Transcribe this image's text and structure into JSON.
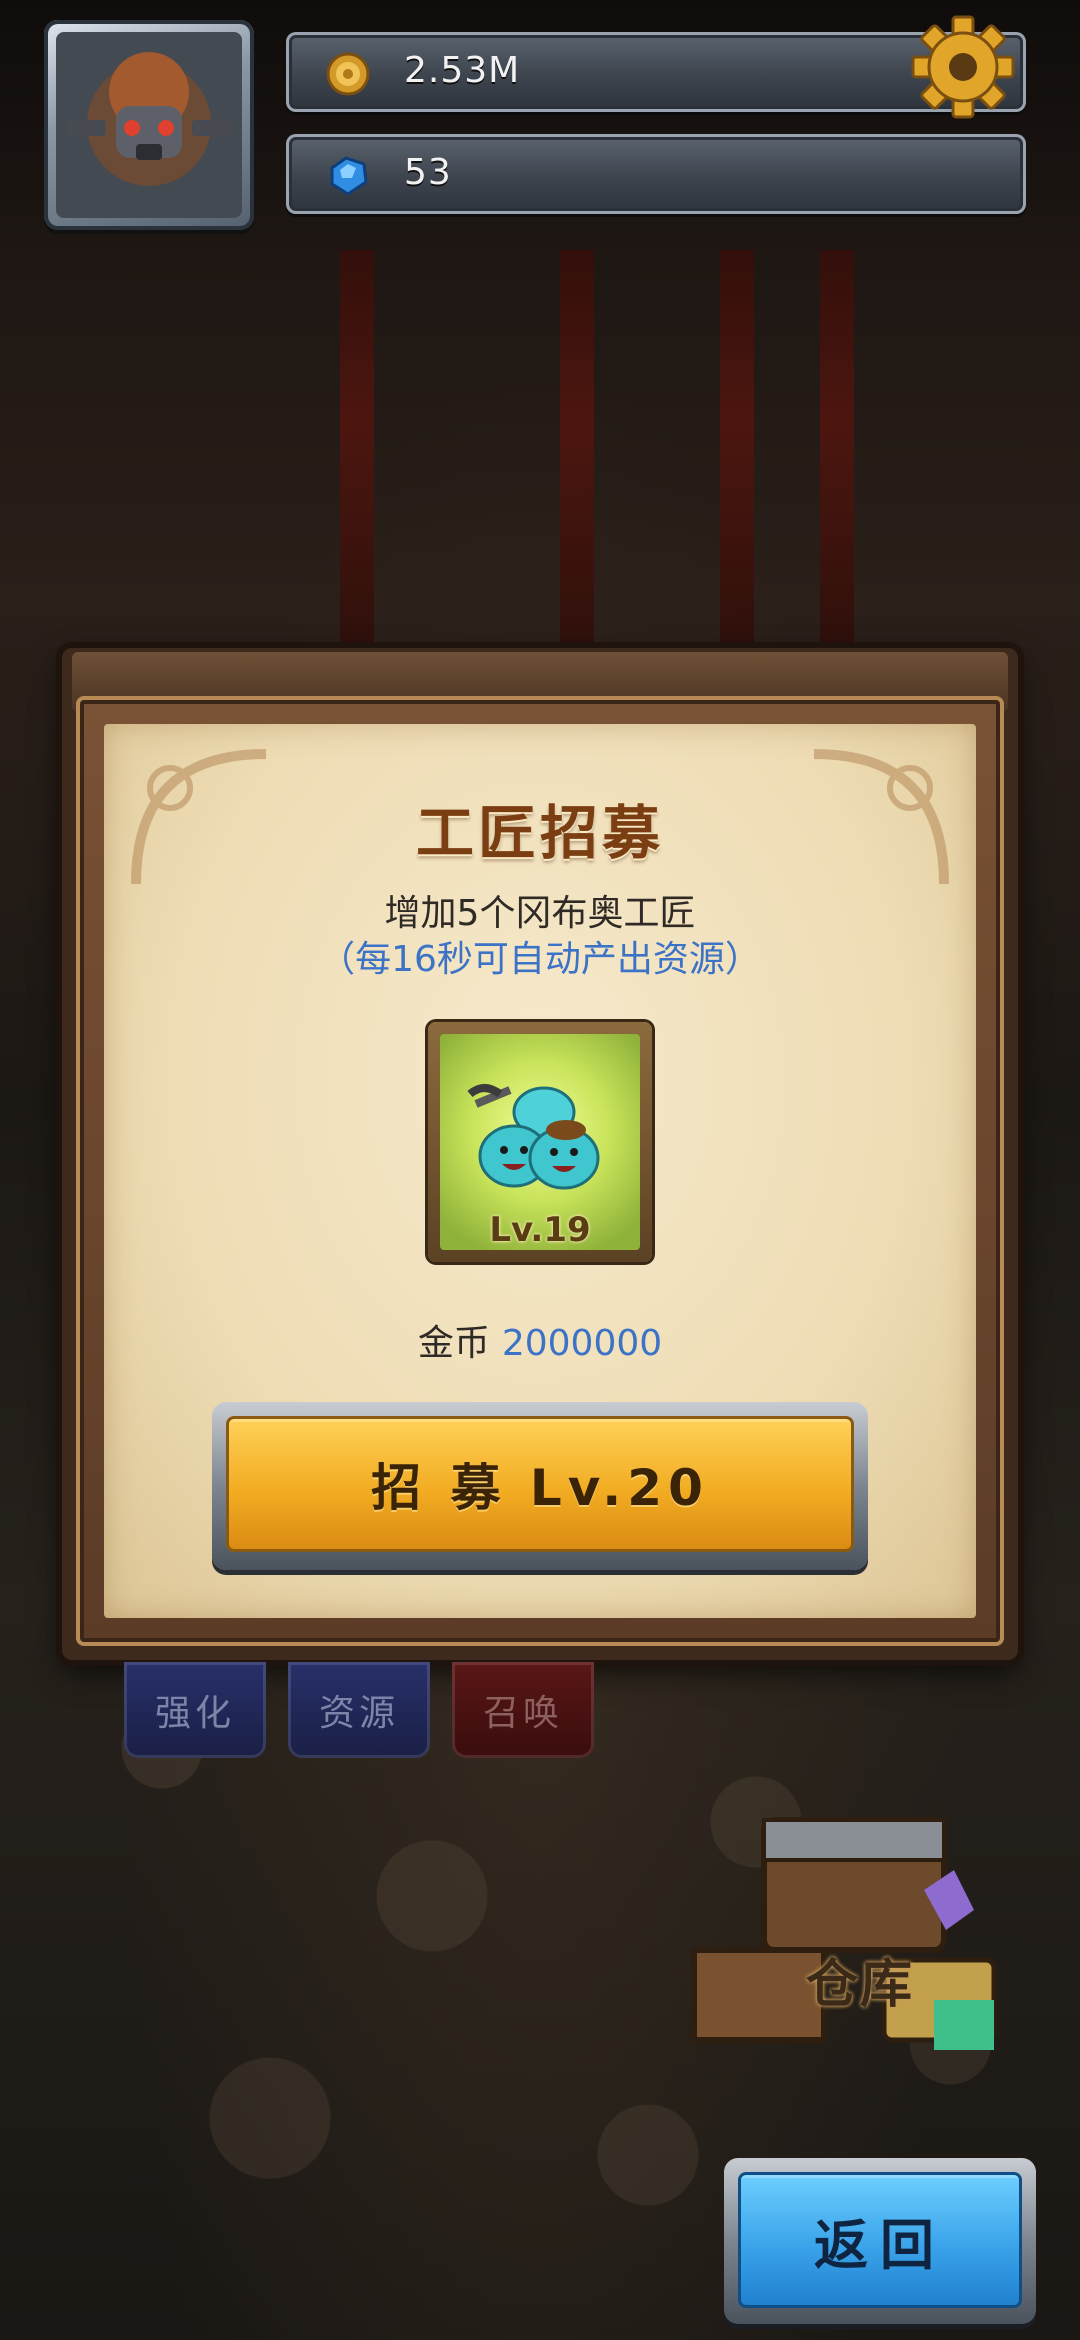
{
  "hud": {
    "gold_amount": "2.53M",
    "gem_amount": "53"
  },
  "modal": {
    "title": "工匠招募",
    "description": "增加5个冈布奥工匠",
    "description_note": "（每16秒可自动产出资源）",
    "unit_level": "Lv.19",
    "cost_label": "金币",
    "cost_value": "2000000",
    "recruit_button": "招 募 Lv.20"
  },
  "tabs": [
    {
      "label": "强化"
    },
    {
      "label": "资源"
    },
    {
      "label": "召唤"
    }
  ],
  "warehouse_label": "仓库",
  "back_button": "返回",
  "colors": {
    "title_brown": "#7b3e12",
    "note_blue": "#3d73c7",
    "recruit_orange": "#f2ac22",
    "back_blue": "#3aa3ea"
  },
  "icons": {
    "gold": "coin-icon",
    "gem": "gem-icon",
    "settings": "gear-icon"
  }
}
